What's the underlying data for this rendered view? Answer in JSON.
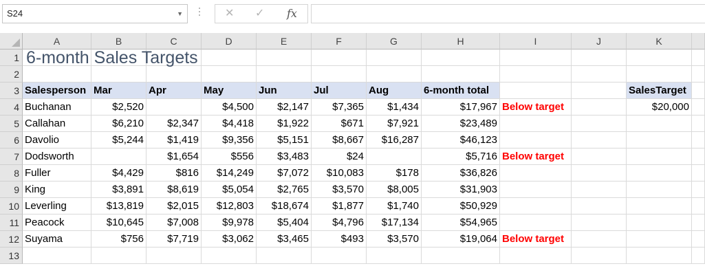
{
  "formula_bar": {
    "name_box": "S24",
    "cancel_icon": "✕",
    "enter_icon": "✓",
    "fx_label": "fx",
    "formula": ""
  },
  "columns": [
    "A",
    "B",
    "C",
    "D",
    "E",
    "F",
    "G",
    "H",
    "I",
    "J",
    "K"
  ],
  "rows": [
    "1",
    "2",
    "3",
    "4",
    "5",
    "6",
    "7",
    "8",
    "9",
    "10",
    "11",
    "12",
    "13"
  ],
  "sheet": {
    "title": "6-month Sales Targets",
    "headers": [
      "Salesperson",
      "Mar",
      "Apr",
      "May",
      "Jun",
      "Jul",
      "Aug",
      "6-month total"
    ],
    "records": [
      {
        "name": "Buchanan",
        "values": [
          "$2,520",
          "",
          "$4,500",
          "$2,147",
          "$7,365",
          "$1,434"
        ],
        "total": "$17,967",
        "flag": "Below target"
      },
      {
        "name": "Callahan",
        "values": [
          "$6,210",
          "$2,347",
          "$4,418",
          "$1,922",
          "$671",
          "$7,921"
        ],
        "total": "$23,489",
        "flag": ""
      },
      {
        "name": "Davolio",
        "values": [
          "$5,244",
          "$1,419",
          "$9,356",
          "$5,151",
          "$8,667",
          "$16,287"
        ],
        "total": "$46,123",
        "flag": ""
      },
      {
        "name": "Dodsworth",
        "values": [
          "",
          "$1,654",
          "$556",
          "$3,483",
          "$24",
          ""
        ],
        "total": "$5,716",
        "flag": "Below target"
      },
      {
        "name": "Fuller",
        "values": [
          "$4,429",
          "$816",
          "$14,249",
          "$7,072",
          "$10,083",
          "$178"
        ],
        "total": "$36,826",
        "flag": ""
      },
      {
        "name": "King",
        "values": [
          "$3,891",
          "$8,619",
          "$5,054",
          "$2,765",
          "$3,570",
          "$8,005"
        ],
        "total": "$31,903",
        "flag": ""
      },
      {
        "name": "Leverling",
        "values": [
          "$13,819",
          "$2,015",
          "$12,803",
          "$18,674",
          "$1,877",
          "$1,740"
        ],
        "total": "$50,929",
        "flag": ""
      },
      {
        "name": "Peacock",
        "values": [
          "$10,645",
          "$7,008",
          "$9,978",
          "$5,404",
          "$4,796",
          "$17,134"
        ],
        "total": "$54,965",
        "flag": ""
      },
      {
        "name": "Suyama",
        "values": [
          "$756",
          "$7,719",
          "$3,062",
          "$3,465",
          "$493",
          "$3,570"
        ],
        "total": "$19,064",
        "flag": "Below target"
      }
    ],
    "target_label": "SalesTarget",
    "target_value": "$20,000"
  },
  "colors": {
    "header_fill": "#d9e1f2",
    "flag_text": "#ff0000",
    "title_text": "#44546a"
  }
}
